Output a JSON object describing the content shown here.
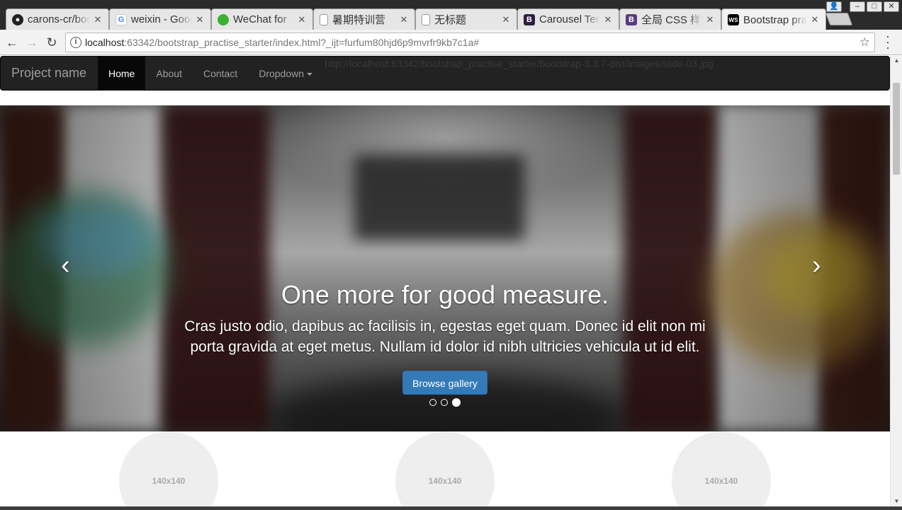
{
  "browser": {
    "tabs": [
      {
        "title": "carons-cr/bootstrap",
        "icon": "github-icon",
        "active": false
      },
      {
        "title": "weixin - Google",
        "icon": "google-icon",
        "active": false
      },
      {
        "title": "WeChat for",
        "icon": "wechat-icon",
        "active": false
      },
      {
        "title": "暑期特训营",
        "icon": "document-icon",
        "active": false
      },
      {
        "title": "无标题",
        "icon": "document-icon",
        "active": false
      },
      {
        "title": "Carousel Template",
        "icon": "bootstrap-icon",
        "active": false
      },
      {
        "title": "全局 CSS 样式",
        "icon": "bootstrap-icon",
        "active": false
      },
      {
        "title": "Bootstrap practise",
        "icon": "webstorm-icon",
        "active": true
      }
    ],
    "url_host": "localhost",
    "url_rest": ":63342/bootstrap_practise_starter/index.html?_ijt=furfum80hjd6p9mvrfr9kb7c1a#",
    "hover_status_url": "http://localhost:63342/bootstrap_practise_starter/bootstrap-3.3.7-dist/images/slide-03.jpg"
  },
  "navbar": {
    "brand": "Project name",
    "links": [
      "Home",
      "About",
      "Contact",
      "Dropdown"
    ],
    "active": "Home"
  },
  "carousel": {
    "heading": "One more for good measure.",
    "text": "Cras justo odio, dapibus ac facilisis in, egestas eget quam. Donec id elit non mi porta gravida at eget metus. Nullam id dolor id nibh ultricies vehicula ut id elit.",
    "button": "Browse gallery",
    "prev": "‹",
    "next": "›",
    "slides": 3,
    "active_slide": 3
  },
  "marketing": {
    "placeholders": [
      "140x140",
      "140x140",
      "140x140"
    ]
  },
  "colors": {
    "navbar_bg": "#222222",
    "primary": "#337ab7",
    "placeholder": "#eeeeee"
  }
}
